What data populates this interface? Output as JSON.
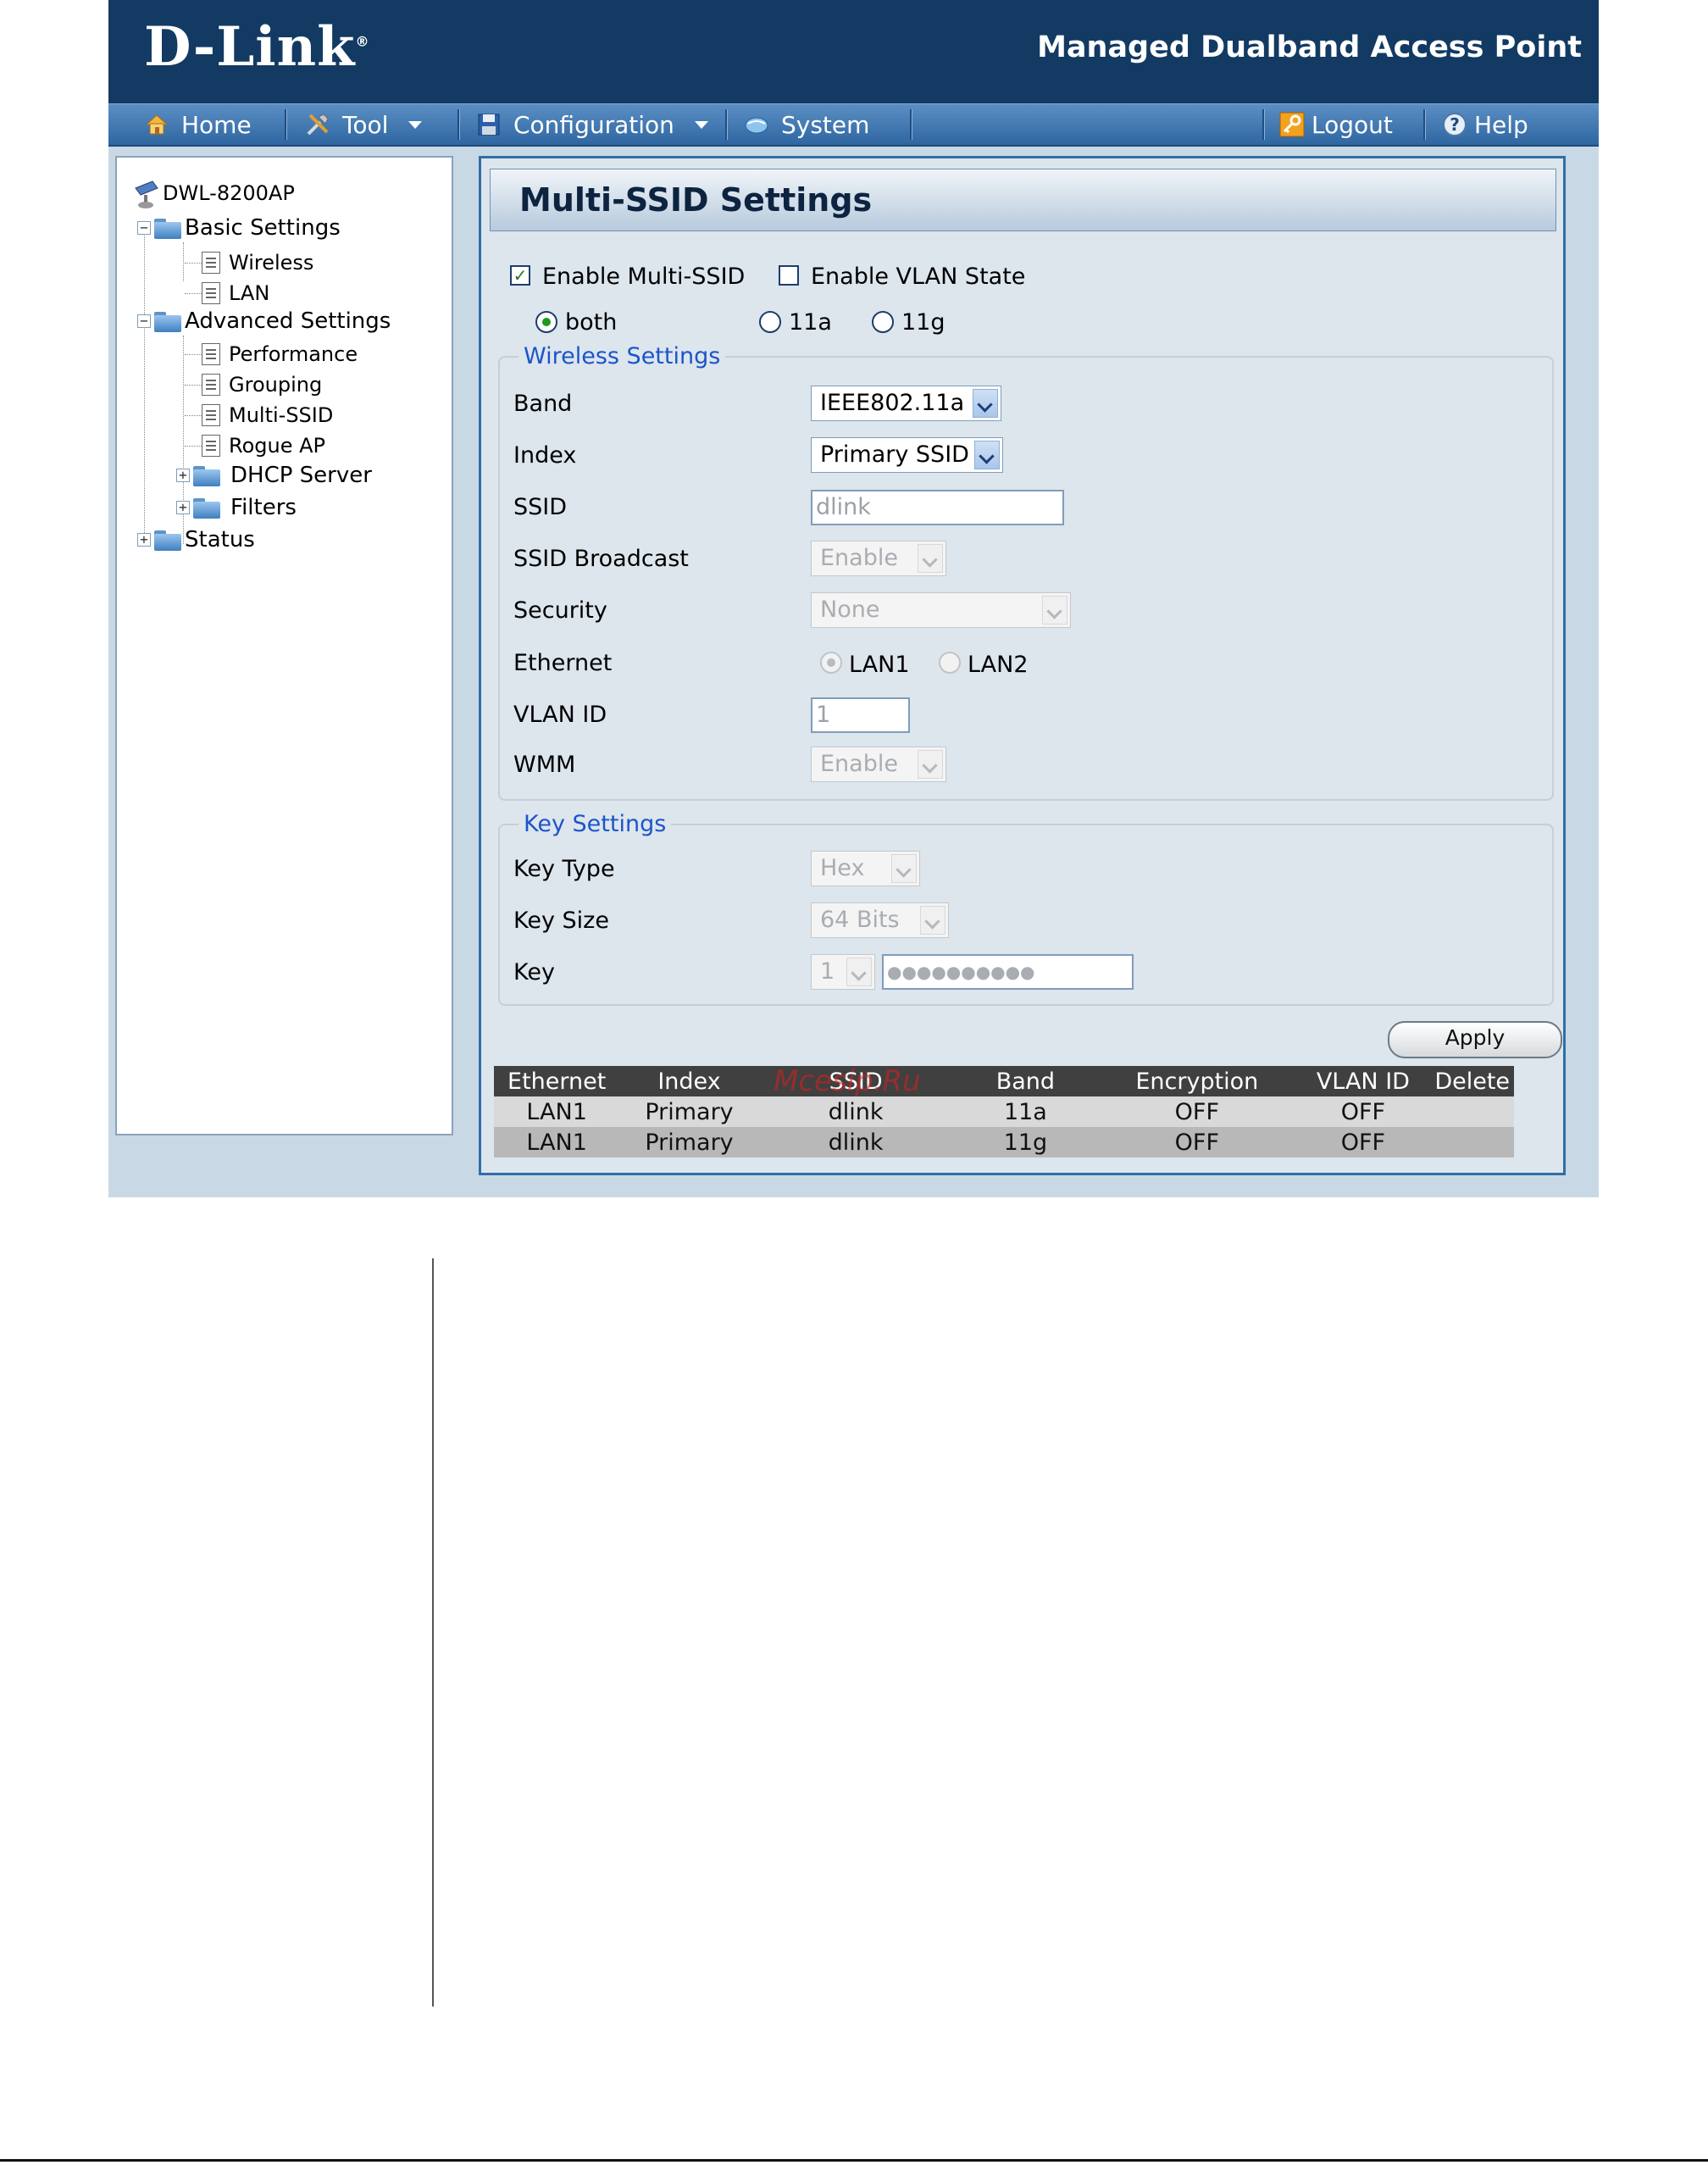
{
  "header": {
    "brand": "D-Link",
    "brand_mark": "®",
    "product": "Managed Dualband Access Point"
  },
  "menu": {
    "home": "Home",
    "tool": "Tool",
    "configuration": "Configuration",
    "system": "System",
    "logout": "Logout",
    "help": "Help"
  },
  "tree": {
    "root": "DWL-8200AP",
    "basic": "Basic Settings",
    "wireless": "Wireless",
    "lan": "LAN",
    "advanced": "Advanced Settings",
    "performance": "Performance",
    "grouping": "Grouping",
    "multissid": "Multi-SSID",
    "rogue": "Rogue AP",
    "dhcp": "DHCP Server",
    "filters": "Filters",
    "status": "Status"
  },
  "page": {
    "title": "Multi-SSID Settings",
    "enable_multi_ssid": "Enable Multi-SSID",
    "enable_vlan": "Enable VLAN State",
    "radio_both": "both",
    "radio_11a": "11a",
    "radio_11g": "11g"
  },
  "wireless": {
    "legend": "Wireless Settings",
    "band_label": "Band",
    "band_value": "IEEE802.11a",
    "index_label": "Index",
    "index_value": "Primary SSID",
    "ssid_label": "SSID",
    "ssid_value": "dlink",
    "broadcast_label": "SSID Broadcast",
    "broadcast_value": "Enable",
    "security_label": "Security",
    "security_value": "None",
    "ethernet_label": "Ethernet",
    "lan1": "LAN1",
    "lan2": "LAN2",
    "vlan_label": "VLAN ID",
    "vlan_value": "1",
    "wmm_label": "WMM",
    "wmm_value": "Enable"
  },
  "keys": {
    "legend": "Key Settings",
    "type_label": "Key Type",
    "type_value": "Hex",
    "size_label": "Key Size",
    "size_value": "64 Bits",
    "key_label": "Key",
    "key_index": "1",
    "key_value": "●●●●●●●●●●"
  },
  "apply_label": "Apply",
  "table": {
    "headers": [
      "Ethernet",
      "Index",
      "SSID",
      "Band",
      "Encryption",
      "VLAN ID",
      "Delete"
    ],
    "rows": [
      [
        "LAN1",
        "Primary",
        "dlink",
        "11a",
        "OFF",
        "OFF",
        ""
      ],
      [
        "LAN1",
        "Primary",
        "dlink",
        "11g",
        "OFF",
        "OFF",
        ""
      ]
    ]
  },
  "watermark": "Mcesip.Ru",
  "colors": {
    "header_bg": "#123a63",
    "menu_bg": "#3a72ab",
    "legend": "#1c55c8",
    "table_header": "#404040"
  }
}
